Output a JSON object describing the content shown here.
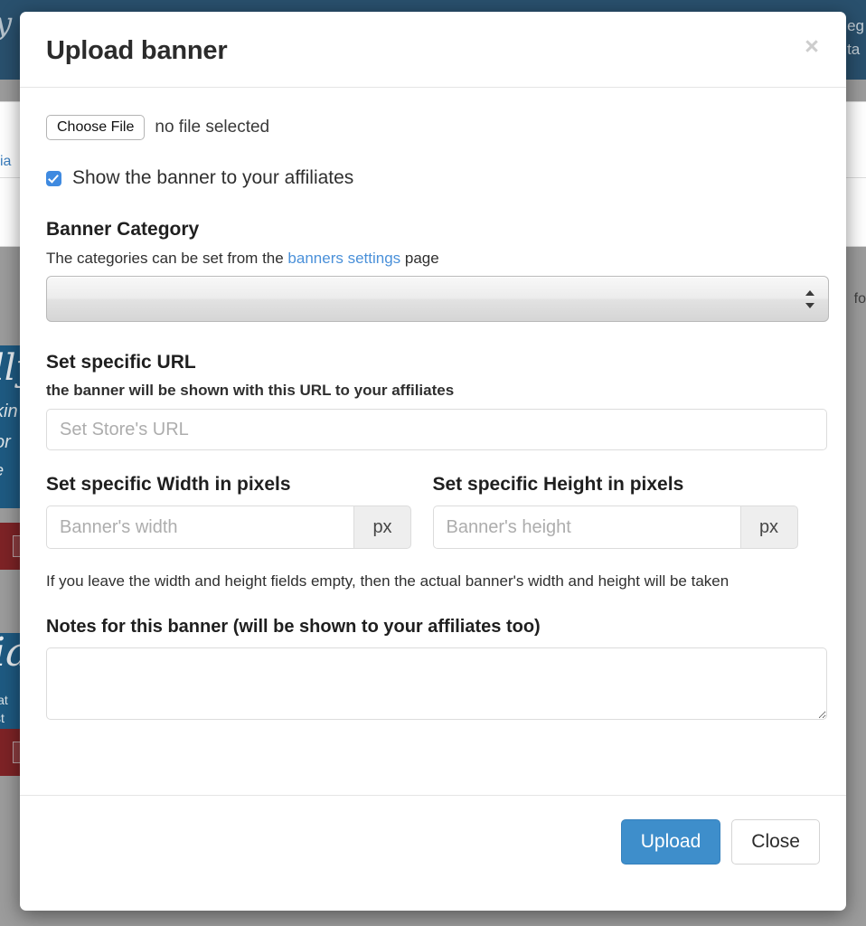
{
  "background": {
    "navbar_script_logo": "y",
    "navbar_links": [
      "eg",
      "ta"
    ],
    "row_labels": [
      "ia",
      "fo"
    ],
    "tiles": [
      {
        "script": "lly",
        "line2": "kin",
        "line3": "or",
        "line4": "e",
        "color": "#1e5a82"
      },
      {
        "color": "#7e2326"
      },
      {
        "script": "ia",
        "line2": "iat",
        "line3": "st",
        "color": "#1e5a82"
      },
      {
        "color": "#7e2326"
      }
    ]
  },
  "modal": {
    "title": "Upload banner",
    "close_label": "×",
    "file": {
      "button_label": "Choose File",
      "status": "no file selected"
    },
    "show_banner_checkbox": {
      "label": "Show the banner to your affiliates",
      "checked": true
    },
    "banner_category": {
      "title": "Banner Category",
      "help_prefix": "The categories can be set from the ",
      "help_link": "banners settings",
      "help_suffix": " page",
      "selected_value": "",
      "options": [
        ""
      ]
    },
    "specific_url": {
      "title": "Set specific URL",
      "subtitle": "the banner will be shown with this URL to your affiliates",
      "value": "",
      "placeholder": "Set Store's URL"
    },
    "width": {
      "title": "Set specific Width in pixels",
      "value": "",
      "placeholder": "Banner's width",
      "addon": "px"
    },
    "height": {
      "title": "Set specific Height in pixels",
      "value": "",
      "placeholder": "Banner's height",
      "addon": "px"
    },
    "size_hint": "If you leave the width and height fields empty, then the actual banner's width and height will be taken",
    "notes": {
      "title": "Notes for this banner (will be shown to your affiliates too)",
      "value": "",
      "placeholder": ""
    },
    "footer": {
      "upload_label": "Upload",
      "close_label": "Close"
    }
  },
  "colors": {
    "primary": "#3e8ecb",
    "link": "#4a90d9",
    "checkbox": "#3f8ae0",
    "navbar": "#29506d",
    "tile_blue": "#1e5a82",
    "tile_red": "#7e2326",
    "backdrop": "#9c9c9c"
  }
}
